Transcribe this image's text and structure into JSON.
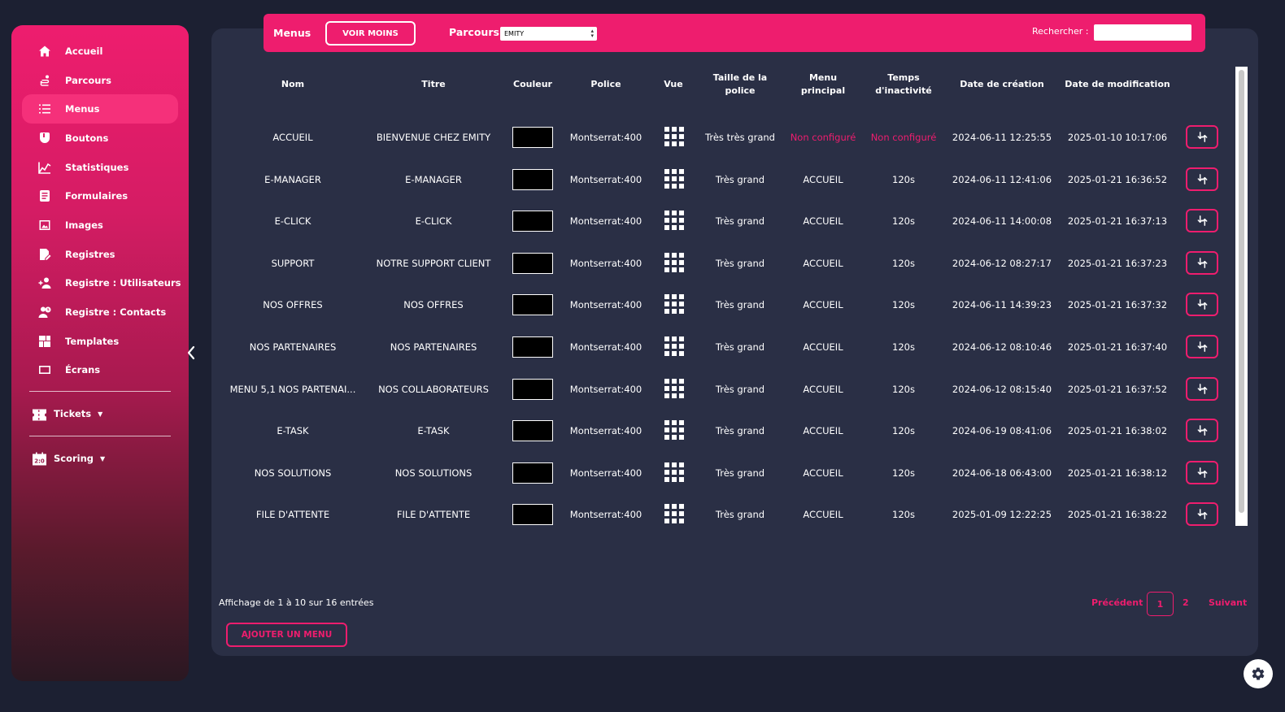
{
  "sidebar": {
    "items": [
      {
        "label": "Accueil",
        "icon": "home-icon"
      },
      {
        "label": "Parcours",
        "icon": "route-icon"
      },
      {
        "label": "Menus",
        "icon": "list-icon",
        "active": true
      },
      {
        "label": "Boutons",
        "icon": "hand-pointer-icon"
      },
      {
        "label": "Statistiques",
        "icon": "chart-line-icon"
      },
      {
        "label": "Formulaires",
        "icon": "form-icon"
      },
      {
        "label": "Images",
        "icon": "image-icon"
      },
      {
        "label": "Registres",
        "icon": "file-signature-icon"
      },
      {
        "label": "Registre : Utilisateurs",
        "icon": "user-plus-icon"
      },
      {
        "label": "Registre : Contacts",
        "icon": "user-clock-icon"
      },
      {
        "label": "Templates",
        "icon": "layout-icon"
      },
      {
        "label": "Écrans",
        "icon": "screen-icon"
      }
    ],
    "groups": [
      {
        "label": "Tickets",
        "icon": "ticket-icon"
      },
      {
        "label": "Scoring",
        "icon": "scoreboard-icon"
      }
    ]
  },
  "topbar": {
    "title": "Menus",
    "toggle_button": "VOIR MOINS",
    "parcours_label": "Parcours",
    "parcours_value": "EMITY",
    "search_label": "Rechercher :",
    "search_value": ""
  },
  "table": {
    "headers": [
      "Nom",
      "Titre",
      "Couleur",
      "Police",
      "Vue",
      "Taille de la\npolice",
      "Menu\nprincipal",
      "Temps\nd'inactivité",
      "Date de création",
      "Date de modification"
    ],
    "rows": [
      {
        "nom": "ACCUEIL",
        "titre": "BIENVENUE CHEZ EMITY",
        "couleur": "#000000",
        "police": "Montserrat:400",
        "taille": "Très très grand",
        "menu": "Non configuré",
        "temps": "Non configuré",
        "creation": "2024-06-11 12:25:55",
        "modification": "2025-01-10 10:17:06"
      },
      {
        "nom": "E-MANAGER",
        "titre": "E-MANAGER",
        "couleur": "#000000",
        "police": "Montserrat:400",
        "taille": "Très grand",
        "menu": "ACCUEIL",
        "temps": "120s",
        "creation": "2024-06-11 12:41:06",
        "modification": "2025-01-21 16:36:52"
      },
      {
        "nom": "E-CLICK",
        "titre": "E-CLICK",
        "couleur": "#000000",
        "police": "Montserrat:400",
        "taille": "Très grand",
        "menu": "ACCUEIL",
        "temps": "120s",
        "creation": "2024-06-11 14:00:08",
        "modification": "2025-01-21 16:37:13"
      },
      {
        "nom": "SUPPORT",
        "titre": "NOTRE SUPPORT CLIENT",
        "couleur": "#000000",
        "police": "Montserrat:400",
        "taille": "Très grand",
        "menu": "ACCUEIL",
        "temps": "120s",
        "creation": "2024-06-12 08:27:17",
        "modification": "2025-01-21 16:37:23"
      },
      {
        "nom": "NOS OFFRES",
        "titre": "NOS OFFRES",
        "couleur": "#000000",
        "police": "Montserrat:400",
        "taille": "Très grand",
        "menu": "ACCUEIL",
        "temps": "120s",
        "creation": "2024-06-11 14:39:23",
        "modification": "2025-01-21 16:37:32"
      },
      {
        "nom": "NOS PARTENAIRES",
        "titre": "NOS PARTENAIRES",
        "couleur": "#000000",
        "police": "Montserrat:400",
        "taille": "Très grand",
        "menu": "ACCUEIL",
        "temps": "120s",
        "creation": "2024-06-12 08:10:46",
        "modification": "2025-01-21 16:37:40"
      },
      {
        "nom": "MENU 5,1 NOS PARTENAI...",
        "titre": "NOS COLLABORATEURS",
        "couleur": "#000000",
        "police": "Montserrat:400",
        "taille": "Très grand",
        "menu": "ACCUEIL",
        "temps": "120s",
        "creation": "2024-06-12 08:15:40",
        "modification": "2025-01-21 16:37:52"
      },
      {
        "nom": "E-TASK",
        "titre": "E-TASK",
        "couleur": "#000000",
        "police": "Montserrat:400",
        "taille": "Très grand",
        "menu": "ACCUEIL",
        "temps": "120s",
        "creation": "2024-06-19 08:41:06",
        "modification": "2025-01-21 16:38:02"
      },
      {
        "nom": "NOS SOLUTIONS",
        "titre": "NOS SOLUTIONS",
        "couleur": "#000000",
        "police": "Montserrat:400",
        "taille": "Très grand",
        "menu": "ACCUEIL",
        "temps": "120s",
        "creation": "2024-06-18 06:43:00",
        "modification": "2025-01-21 16:38:12"
      },
      {
        "nom": "FILE D'ATTENTE",
        "titre": "FILE D'ATTENTE",
        "couleur": "#000000",
        "police": "Montserrat:400",
        "taille": "Très grand",
        "menu": "ACCUEIL",
        "temps": "120s",
        "creation": "2025-01-09 12:22:25",
        "modification": "2025-01-21 16:38:22"
      }
    ]
  },
  "footer": {
    "info": "Affichage de 1 à 10 sur 16 entrées",
    "add_button": "AJOUTER UN MENU",
    "prev": "Précédent",
    "pages": [
      "1",
      "2"
    ],
    "next": "Suivant"
  },
  "colors": {
    "accent": "#ee1d6e",
    "panel": "#2a2f45",
    "background": "#1c2032"
  }
}
